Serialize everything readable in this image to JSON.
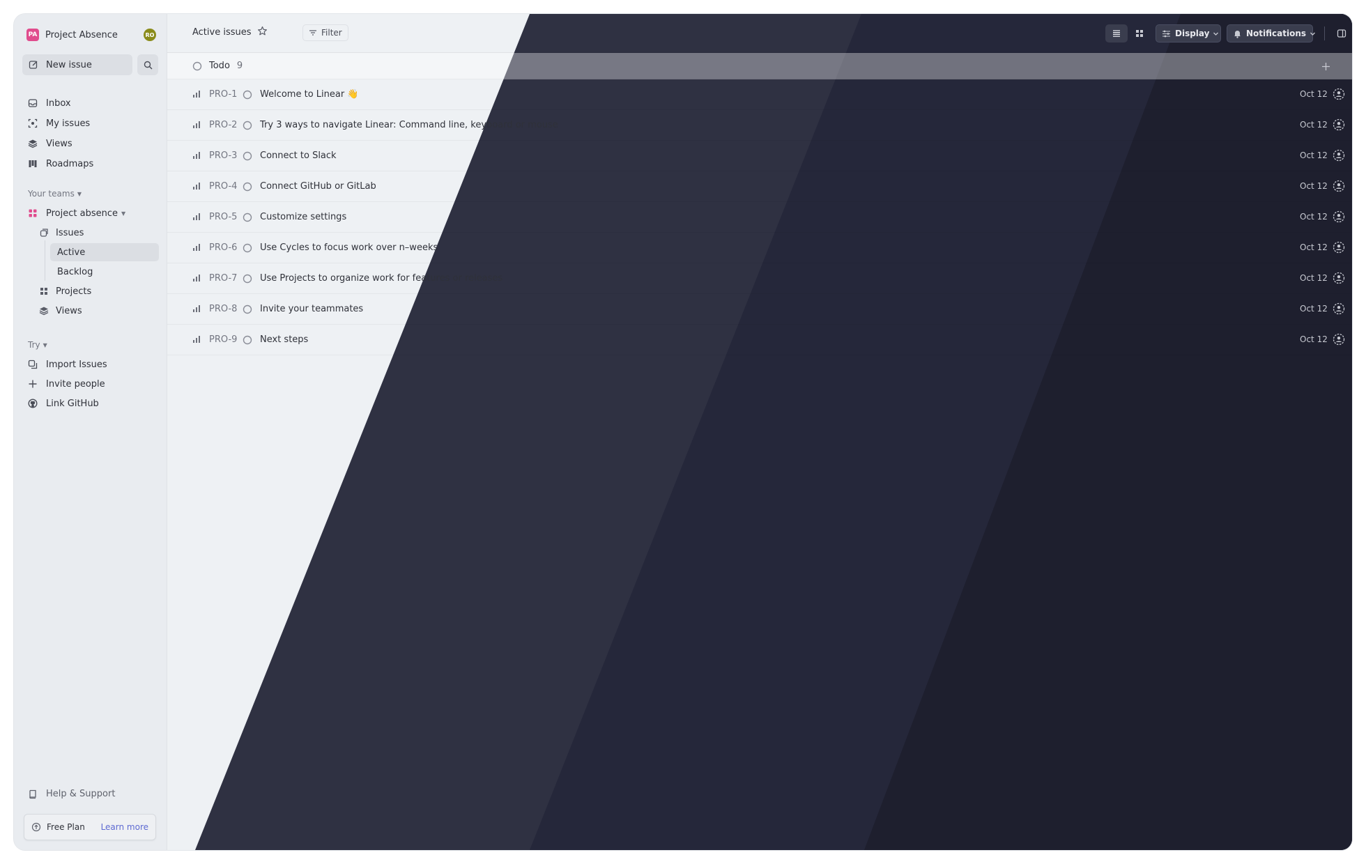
{
  "workspace": {
    "badge": "PA",
    "name": "Project Absence",
    "avatar_initials": "RO"
  },
  "sidebar": {
    "new_issue_label": "New issue",
    "nav": [
      {
        "label": "Inbox",
        "icon": "inbox-icon"
      },
      {
        "label": "My issues",
        "icon": "target-icon"
      },
      {
        "label": "Views",
        "icon": "layers-icon"
      },
      {
        "label": "Roadmaps",
        "icon": "map-icon"
      }
    ],
    "teams_label": "Your teams",
    "team": {
      "name": "Project absence",
      "issues_label": "Issues",
      "issues_sub": [
        "Active",
        "Backlog"
      ],
      "projects_label": "Projects",
      "views_label": "Views"
    },
    "try_label": "Try",
    "try_items": [
      {
        "label": "Import Issues",
        "icon": "import-icon"
      },
      {
        "label": "Invite people",
        "icon": "plus-icon"
      },
      {
        "label": "Link GitHub",
        "icon": "github-icon"
      }
    ],
    "help_label": "Help & Support",
    "plan": {
      "label": "Free Plan",
      "learn_more": "Learn more"
    }
  },
  "header": {
    "title": "Active issues",
    "filter_label": "Filter",
    "display_label": "Display",
    "notifications_label": "Notifications"
  },
  "group": {
    "label": "Todo",
    "count": "9"
  },
  "issues": [
    {
      "id": "PRO-1",
      "title": "Welcome to Linear 👋",
      "date": "Oct 12"
    },
    {
      "id": "PRO-2",
      "title": "Try 3 ways to navigate Linear: Command line, keyboard or mouse",
      "date": "Oct 12"
    },
    {
      "id": "PRO-3",
      "title": "Connect to Slack",
      "date": "Oct 12"
    },
    {
      "id": "PRO-4",
      "title": "Connect GitHub or GitLab",
      "date": "Oct 12"
    },
    {
      "id": "PRO-5",
      "title": "Customize settings",
      "date": "Oct 12"
    },
    {
      "id": "PRO-6",
      "title": "Use Cycles to focus work over n–weeks",
      "date": "Oct 12"
    },
    {
      "id": "PRO-7",
      "title": "Use Projects to organize work for features or releases",
      "date": "Oct 12"
    },
    {
      "id": "PRO-8",
      "title": "Invite your teammates",
      "date": "Oct 12"
    },
    {
      "id": "PRO-9",
      "title": "Next steps",
      "date": "Oct 12"
    }
  ],
  "colors": {
    "accent": "#5e6ad2",
    "workspace_badge": "#e04c8d",
    "avatar": "#8a8b1a",
    "dark_panel": "#2f3142"
  }
}
